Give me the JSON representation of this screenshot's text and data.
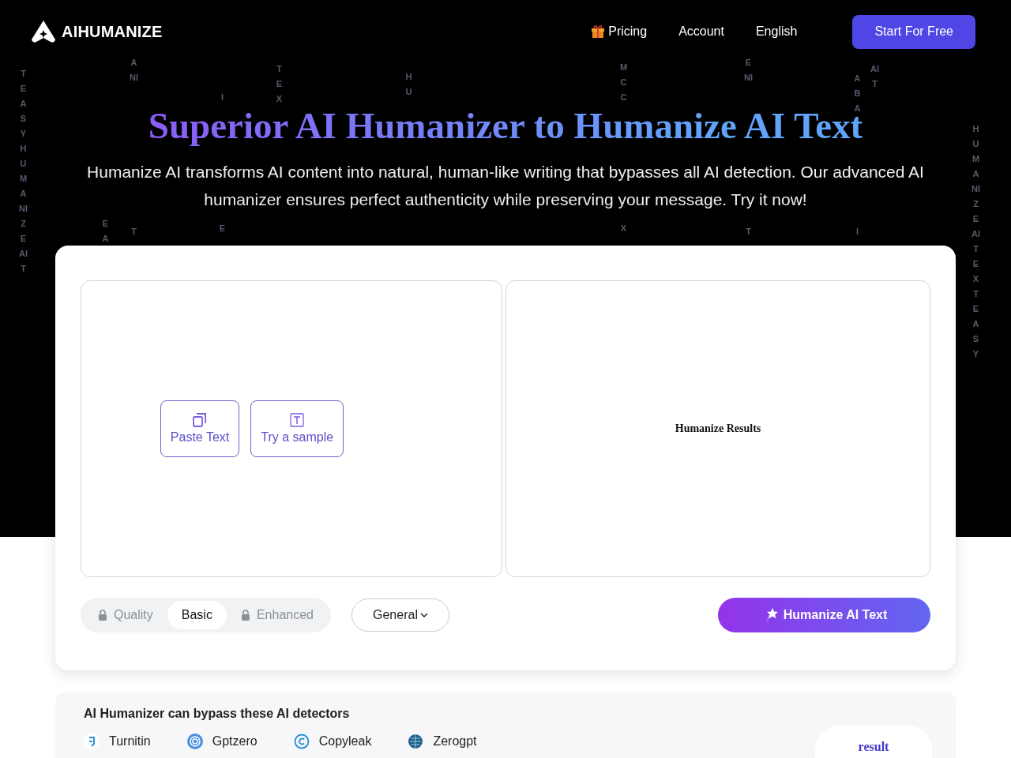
{
  "header": {
    "brand": "AIHUMANIZE",
    "nav": [
      {
        "label": "Pricing",
        "kind": "gift"
      },
      {
        "label": "Account",
        "kind": "plain"
      },
      {
        "label": "English",
        "kind": "plain"
      }
    ],
    "cta": "Start For Free"
  },
  "hero": {
    "title": "Superior AI Humanizer to Humanize AI Text",
    "subtitle": "Humanize AI transforms AI content into natural, human-like writing that bypasses all AI detection. Our advanced AI humanizer ensures perfect authenticity while preserving your message. Try it now!"
  },
  "background_letters": [
    "TEASYHUMANIZEAIT",
    "ANI",
    "EA",
    "I",
    "TEX",
    "HU",
    "MCC",
    "ENI",
    "ABA",
    "AIT",
    "HUMANIZEAITEXTEASY",
    "E",
    "T",
    "X",
    "T",
    "I"
  ],
  "editor": {
    "input_actions": [
      {
        "label": "Paste Text",
        "kind": "paste"
      },
      {
        "label": "Try a sample",
        "kind": "sample"
      }
    ],
    "output_placeholder": "Humanize Results"
  },
  "modes": [
    {
      "label": "Quality",
      "locked": true,
      "selected": false
    },
    {
      "label": "Basic",
      "locked": false,
      "selected": true
    },
    {
      "label": "Enhanced",
      "locked": true,
      "selected": false
    }
  ],
  "style_dropdown": "General",
  "submit": "Humanize AI Text",
  "detectors": {
    "title": "AI Humanizer can bypass these AI detectors",
    "items": [
      {
        "name": "Turnitin",
        "kind": "turnitin"
      },
      {
        "name": "Gptzero",
        "kind": "gptzero"
      },
      {
        "name": "Copyleak",
        "kind": "copyleak"
      },
      {
        "name": "Zerogpt",
        "kind": "zerogpt"
      }
    ],
    "result_label": "result"
  }
}
